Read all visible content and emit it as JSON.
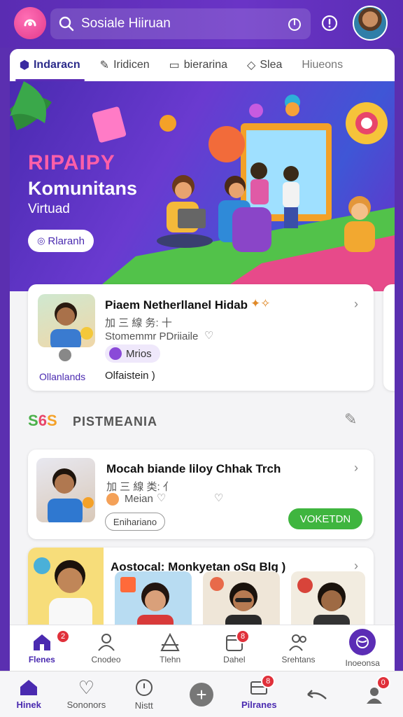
{
  "header": {
    "search_text": "Sosiale Hiiruan"
  },
  "tabs": [
    {
      "label": "Indaracn"
    },
    {
      "label": "Iridicen"
    },
    {
      "label": "bierarina"
    },
    {
      "label": "Slea"
    },
    {
      "label": "Hiueons"
    }
  ],
  "hero": {
    "title": "RIPAIPY",
    "subtitle": "Komunitans",
    "tagline": "Virtuad",
    "button_label": "Rlaranh"
  },
  "card1": {
    "title": "Piaem Netherllanel Hidab",
    "line2": "加 三 線 务: 十",
    "line3": "Stomemmr PDriiaile",
    "tag": "Mrios",
    "left_label": "Ollanlands",
    "right_label": "Olfaistein )"
  },
  "section": {
    "title": "PISTMEANIA"
  },
  "card2": {
    "title": "Mocah biande liloy Chhak Trch",
    "line2": "加 三 線 类: 亻",
    "line3": "Meian",
    "outline_label": "Enihariano",
    "action_label": "VOKETDN"
  },
  "card3": {
    "title": "Aostocal: Monkyetan oSq Blg )"
  },
  "bottom_nav_primary": [
    {
      "label": "Flenes",
      "badge": "2"
    },
    {
      "label": "Cnodeo",
      "badge": ""
    },
    {
      "label": "Tlehn",
      "badge": ""
    },
    {
      "label": "Dahel",
      "badge": "8"
    },
    {
      "label": "Srehtans",
      "badge": ""
    },
    {
      "label": "Inoeonsa",
      "badge": ""
    }
  ],
  "bottom_nav_secondary": [
    {
      "label": "Hinek",
      "badge": ""
    },
    {
      "label": "Sononors",
      "badge": ""
    },
    {
      "label": "Nistt",
      "badge": ""
    },
    {
      "label": "",
      "badge": ""
    },
    {
      "label": "Pilranes",
      "badge": "8"
    },
    {
      "label": "",
      "badge": ""
    },
    {
      "label": "",
      "badge": "0"
    }
  ],
  "colors": {
    "brand_purple": "#5b2db5",
    "accent_pink": "#ff5fa8",
    "action_green": "#3fb53f",
    "badge_red": "#e0303a"
  }
}
